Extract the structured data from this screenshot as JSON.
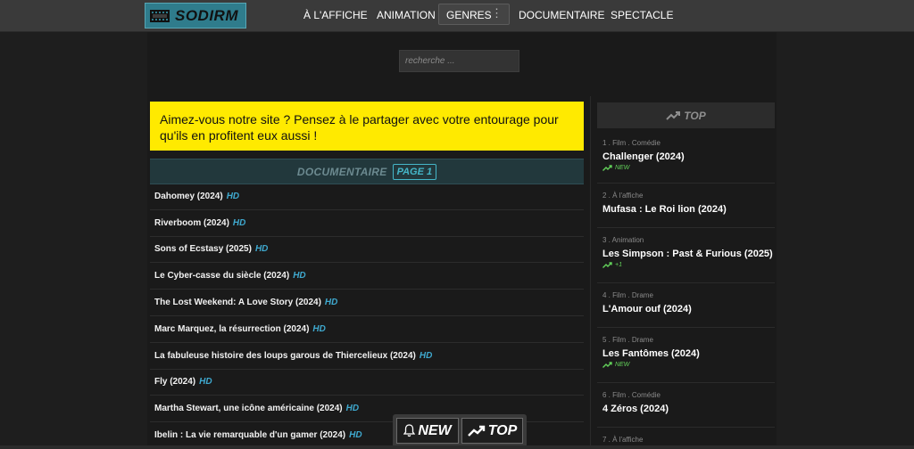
{
  "header": {
    "logo_text": "SODIRM",
    "nav": {
      "affiche": "À L'AFFICHE",
      "animation": "ANIMATION",
      "genres": "GENRES",
      "documentaire": "DOCUMENTAIRE",
      "spectacle": "SPECTACLE"
    }
  },
  "search": {
    "placeholder": "recherche ..."
  },
  "banner": {
    "text": "Aimez-vous notre site ? Pensez à le partager avec votre entourage pour qu'ils en profitent eux aussi !"
  },
  "section": {
    "title": "DOCUMENTAIRE",
    "page_label": "PAGE 1"
  },
  "list": {
    "hd_label": "HD",
    "items": [
      "Dahomey (2024)",
      "Riverboom (2024)",
      "Sons of Ecstasy (2025)",
      "Le Cyber-casse du siècle (2024)",
      "The Lost Weekend: A Love Story (2024)",
      "Marc Marquez, la résurrection (2024)",
      "La fabuleuse histoire des loups garous de Thiercelieux (2024)",
      "Fly (2024)",
      "Martha Stewart, une icône américaine (2024)",
      "Ibelin : La vie remarquable d'un gamer (2024)"
    ]
  },
  "top": {
    "title": "TOP",
    "items": [
      {
        "meta": "1 . Film . Comédie",
        "title": "Challenger (2024)",
        "badge": "NEW"
      },
      {
        "meta": "2 . À l'affiche",
        "title": "Mufasa : Le Roi lion (2024)",
        "badge": ""
      },
      {
        "meta": "3 . Animation",
        "title": "Les Simpson : Past & Furious (2025)",
        "badge": "+1"
      },
      {
        "meta": "4 . Film . Drame",
        "title": "L'Amour ouf (2024)",
        "badge": ""
      },
      {
        "meta": "5 . Film . Drame",
        "title": "Les Fantômes (2024)",
        "badge": "NEW"
      },
      {
        "meta": "6 . Film . Comédie",
        "title": "4 Zéros (2024)",
        "badge": ""
      },
      {
        "meta": "7 . À l'affiche",
        "title": "",
        "badge": ""
      }
    ]
  },
  "floating": {
    "new_label": "NEW",
    "top_label": "TOP"
  },
  "colors": {
    "accent": "#45b6c8",
    "banner": "#ffea00",
    "trend": "#63d25a",
    "logo_bg": "#2f7c8c"
  },
  "icons": {
    "trend": "trending-up-icon",
    "bell": "bell-icon",
    "logo": "film-icon"
  }
}
